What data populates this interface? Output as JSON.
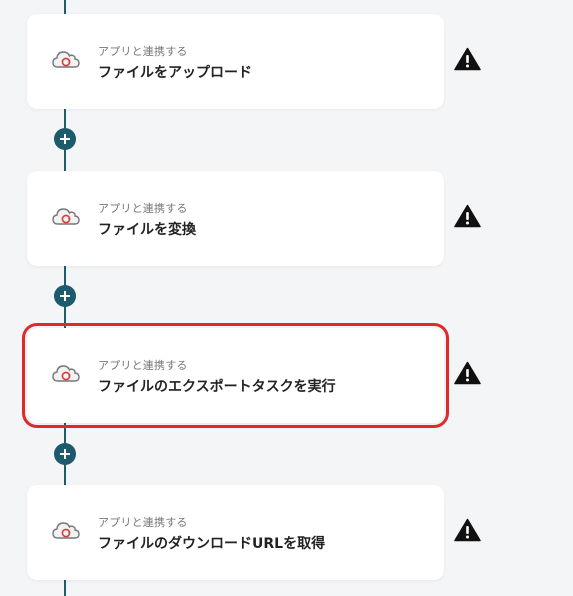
{
  "steps": [
    {
      "subtitle": "アプリと連携する",
      "title": "ファイルをアップロード",
      "app_icon": "cloud-convert-icon",
      "status_icon": "warning-icon"
    },
    {
      "subtitle": "アプリと連携する",
      "title": "ファイルを変換",
      "app_icon": "cloud-convert-icon",
      "status_icon": "warning-icon"
    },
    {
      "subtitle": "アプリと連携する",
      "title": "ファイルのエクスポートタスクを実行",
      "app_icon": "cloud-convert-icon",
      "status_icon": "warning-icon",
      "selected": true
    },
    {
      "subtitle": "アプリと連携する",
      "title": "ファイルのダウンロードURLを取得",
      "app_icon": "cloud-convert-icon",
      "status_icon": "warning-icon"
    }
  ],
  "add_step_icon": "plus-icon",
  "colors": {
    "connector": "#1f5c6e",
    "add_button": "#1d5a6c",
    "selection_border": "#e02a2a",
    "warning": "#111111",
    "background": "#f4f5f6"
  }
}
